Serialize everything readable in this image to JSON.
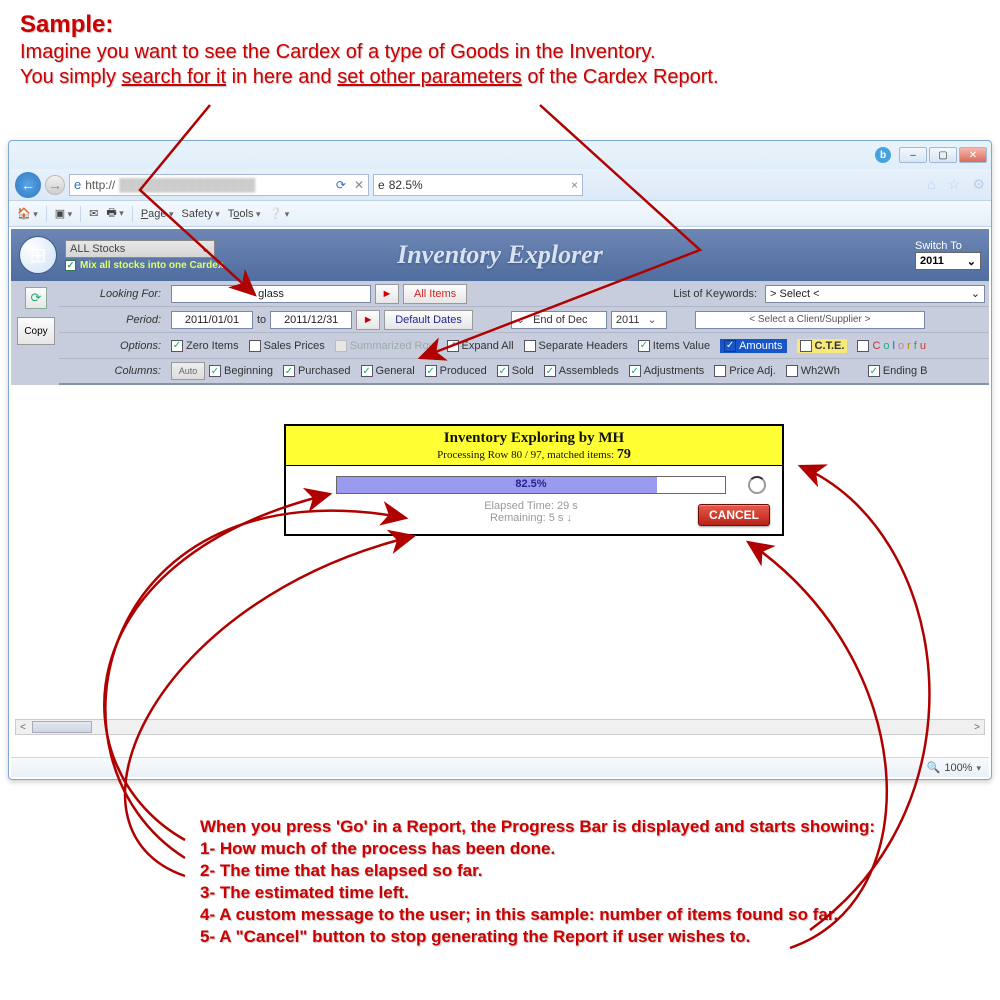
{
  "annotation_top": {
    "title": "Sample:",
    "line1_a": "Imagine you want to see the Cardex of a type of Goods in the Inventory.",
    "line2_a": "You simply ",
    "line2_u1": "search for it",
    "line2_b": " in here and ",
    "line2_u2": "set other parameters",
    "line2_c": " of the Cardex Report."
  },
  "annotation_bottom": {
    "l0": "When you press 'Go' in a Report, the Progress Bar is displayed and starts showing:",
    "l1": "1- How much of the process has been done.",
    "l2": "2- The time that has elapsed so far.",
    "l3": "3- The estimated time left.",
    "l4": "4- A custom message to the user; in this sample: number of items found so far.",
    "l5": "5- A \"Cancel\" button to stop generating the Report if user wishes to."
  },
  "browser": {
    "url_prefix": "http://",
    "tab_title": "82.5%",
    "toolbar": {
      "page": "Page",
      "safety": "Safety",
      "tools": "Tools"
    },
    "zoom": "100%"
  },
  "app": {
    "title": "Inventory Explorer",
    "stock_select": "ALL Stocks",
    "mix_label": "Mix all stocks into one Cardex",
    "switch_label": "Switch To",
    "switch_year": "2011"
  },
  "filters": {
    "looking_label": "Looking For:",
    "looking_value": "glass",
    "all_items": "All Items",
    "keywords_label": "List of Keywords:",
    "keywords_value": "> Select <",
    "period_label": "Period:",
    "period_from": "2011/01/01",
    "period_to_lbl": "to",
    "period_to": "2011/12/31",
    "default_dates": "Default Dates",
    "endof": "End of Dec",
    "endof_year": "2011",
    "client_sel": "< Select a Client/Supplier >",
    "options_label": "Options:",
    "columns_label": "Columns:",
    "auto": "Auto"
  },
  "options": {
    "zero": "Zero Items",
    "sales": "Sales Prices",
    "summarized": "Summarized Row",
    "expand": "Expand All",
    "seph": "Separate Headers",
    "itemsval": "Items Value",
    "amounts": "Amounts",
    "cte": "C.T.E.",
    "colorful": "Colorfu"
  },
  "columns": {
    "beginning": "Beginning",
    "purchased": "Purchased",
    "general": "General",
    "produced": "Produced",
    "sold": "Sold",
    "assembleds": "Assembleds",
    "adjustments": "Adjustments",
    "priceadj": "Price Adj.",
    "wh2wh": "Wh2Wh",
    "endingb": "Ending B"
  },
  "progress": {
    "title": "Inventory Exploring by MH",
    "row_text_a": "Processing Row 80 / 97, matched items: ",
    "row_text_b": "79",
    "percent": "82.5%",
    "percent_val": 82.5,
    "elapsed_lbl": "Elapsed Time:",
    "elapsed_val": "29 s",
    "remaining_lbl": "Remaining:",
    "remaining_val": "5  s  ↓",
    "cancel": "CANCEL"
  }
}
